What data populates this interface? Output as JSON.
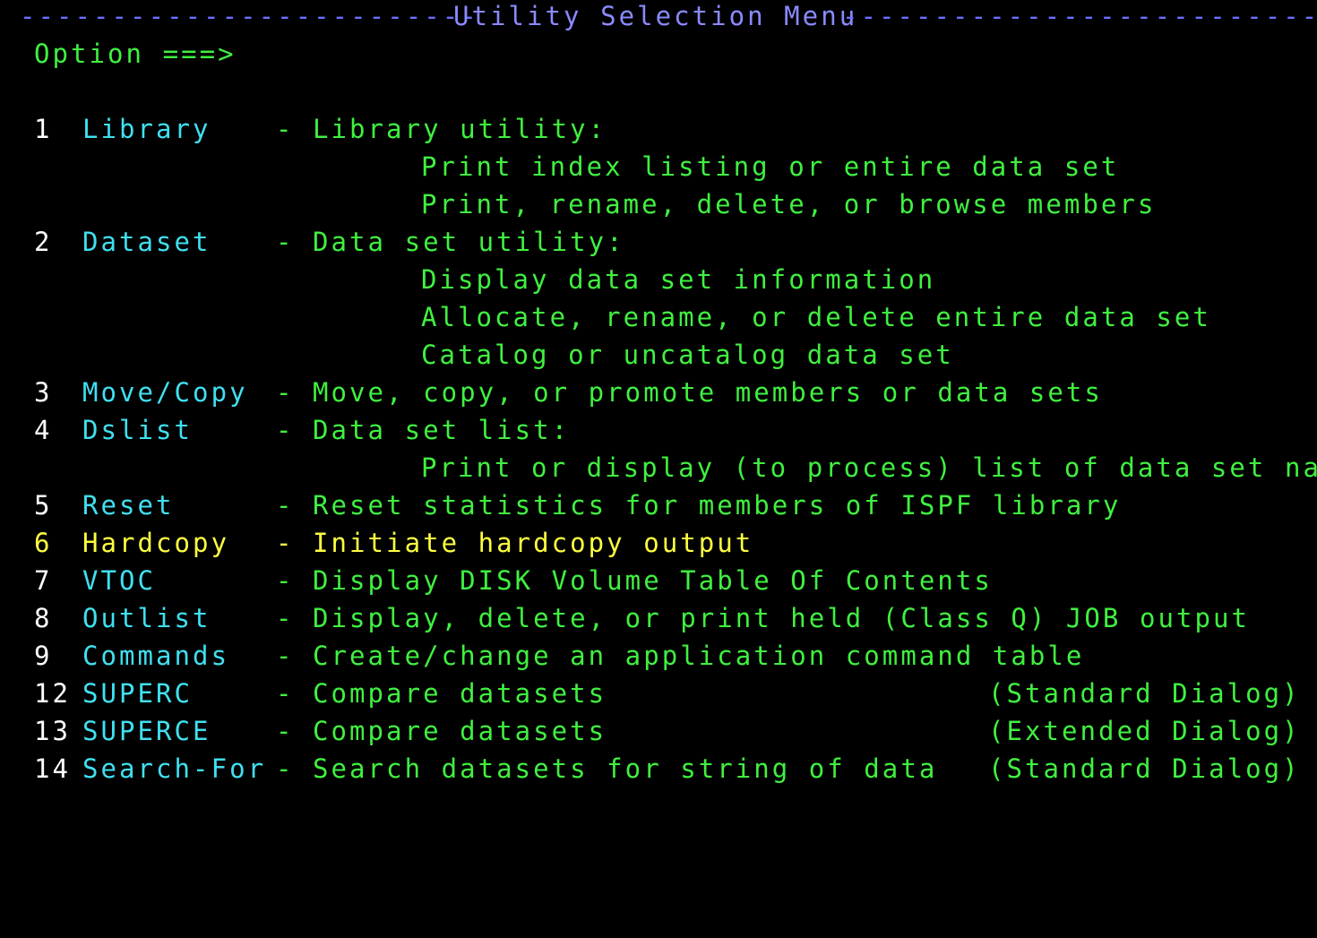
{
  "header": {
    "left_dashes": "-------------------------",
    "title": "Utility Selection Menu",
    "right_dashes": "---------------------------"
  },
  "option": {
    "label": "Option ===>",
    "value": ""
  },
  "menu": [
    {
      "num": "1",
      "name": "Library",
      "desc": "- Library utility:",
      "sub": [
        "Print index listing or entire data set",
        "Print, rename, delete, or browse members"
      ]
    },
    {
      "num": "2",
      "name": "Dataset",
      "desc": "- Data set utility:",
      "sub": [
        "Display data set information",
        "Allocate, rename, or delete entire data set",
        "Catalog or uncatalog data set"
      ]
    },
    {
      "num": "3",
      "name": "Move/Copy",
      "desc": "- Move, copy, or promote members or data sets"
    },
    {
      "num": "4",
      "name": "Dslist",
      "desc": "- Data set list:",
      "sub": [
        "Print or display (to process) list of data set names"
      ]
    },
    {
      "num": "5",
      "name": "Reset",
      "desc": "- Reset statistics for members of ISPF library"
    },
    {
      "num": "6",
      "name": "Hardcopy",
      "desc": "- Initiate hardcopy output"
    },
    {
      "num": "7",
      "name": "VTOC",
      "desc": "- Display DISK Volume Table Of Contents"
    },
    {
      "num": "8",
      "name": "Outlist",
      "desc": "- Display, delete, or print held (Class Q) JOB output"
    },
    {
      "num": "9",
      "name": "Commands",
      "desc": "- Create/change an application command table"
    },
    {
      "num": "12",
      "name": "SUPERC",
      "desc": "- Compare datasets",
      "note": "(Standard Dialog)"
    },
    {
      "num": "13",
      "name": "SUPERCE",
      "desc": "- Compare datasets",
      "note": "(Extended Dialog)"
    },
    {
      "num": "14",
      "name": "Search-For",
      "desc": "- Search datasets for string of data",
      "note": "(Standard Dialog)"
    }
  ],
  "colors": {
    "background": "#000000",
    "number": "#ffffff",
    "option_name": "#40e0f0",
    "description": "#40f040",
    "highlight": "#ffff40",
    "header": "#8a8aff"
  }
}
